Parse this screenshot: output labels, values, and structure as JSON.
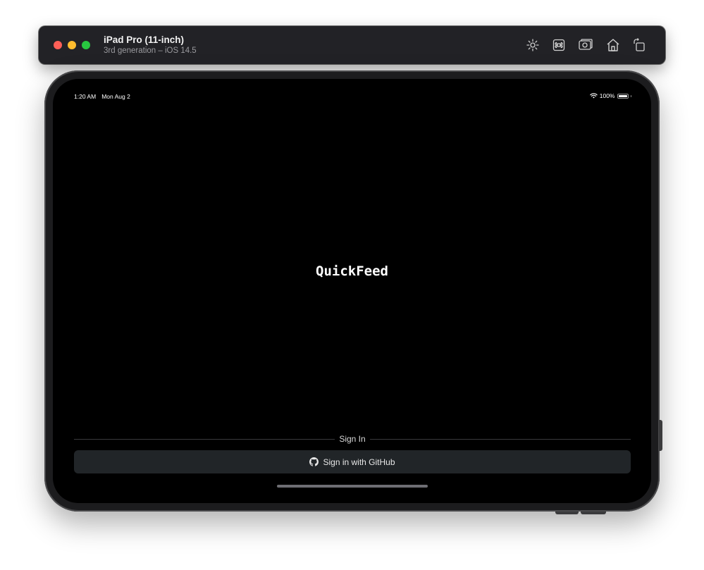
{
  "window": {
    "title": "iPad Pro (11-inch)",
    "subtitle": "3rd generation – iOS 14.5",
    "toolbar_icons": [
      "brightness-icon",
      "command-icon",
      "screenshot-icon",
      "home-icon",
      "rotate-icon"
    ]
  },
  "status_bar": {
    "time": "1:20 AM",
    "date": "Mon Aug 2",
    "battery": "100%"
  },
  "app": {
    "title": "QuickFeed",
    "signin_section_label": "Sign In",
    "signin_button_label": "Sign in with GitHub"
  },
  "colors": {
    "close": "#fe5f57",
    "minimize": "#febc2e",
    "maximize": "#28c840",
    "screen_bg": "#000000",
    "button_bg": "#212528"
  }
}
